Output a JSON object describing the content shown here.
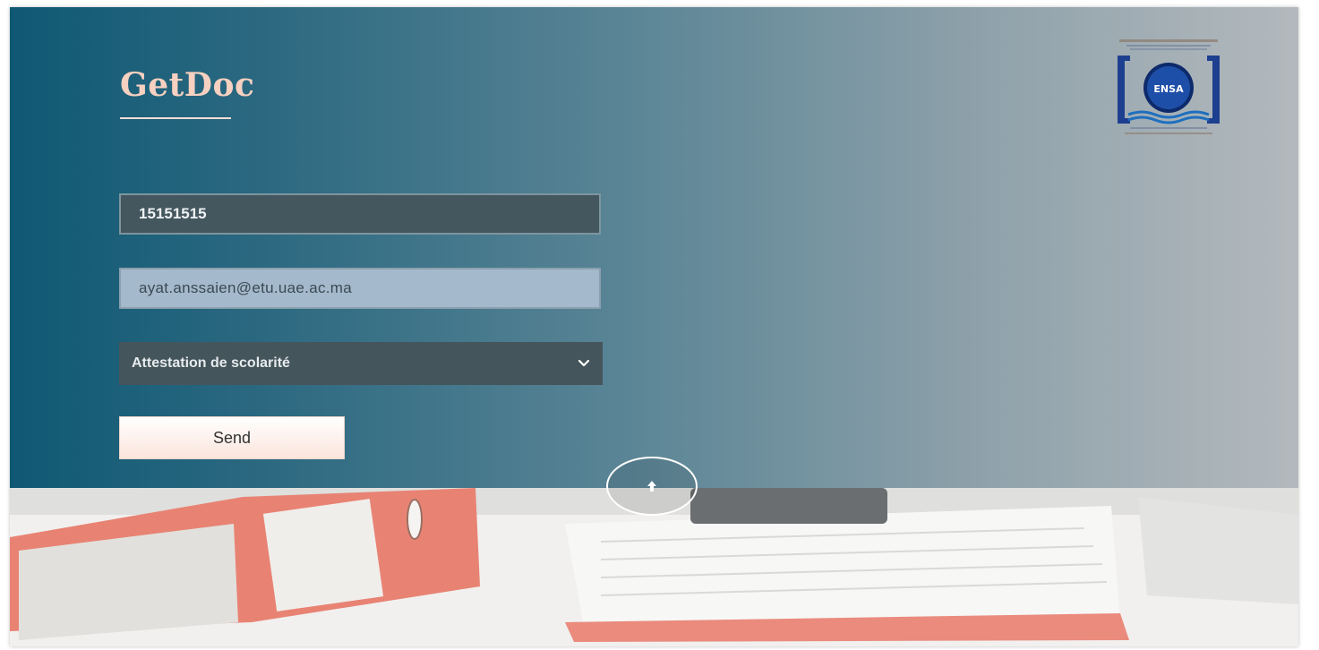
{
  "app": {
    "brand_title": "GetDoc"
  },
  "logo": {
    "icon": "ensa-university-logo",
    "badge_text": "ENSA"
  },
  "form": {
    "id_field": {
      "value": "15151515"
    },
    "email_field": {
      "value": "ayat.anssaien@etu.uae.ac.ma"
    },
    "document_select": {
      "selected": "Attestation de scolarité",
      "icon": "chevron-down-icon"
    },
    "send_label": "Send"
  },
  "scroll_button": {
    "icon": "arrow-up-icon"
  },
  "colors": {
    "brand_title": "#f6d0c0",
    "gradient_start": "#0f5874",
    "gradient_end": "#b3b9bd",
    "id_field_bg": "#45575e",
    "email_field_bg": "#a4b9cb",
    "select_bg": "#45555c",
    "send_button_bg": "#fbe5dc"
  }
}
